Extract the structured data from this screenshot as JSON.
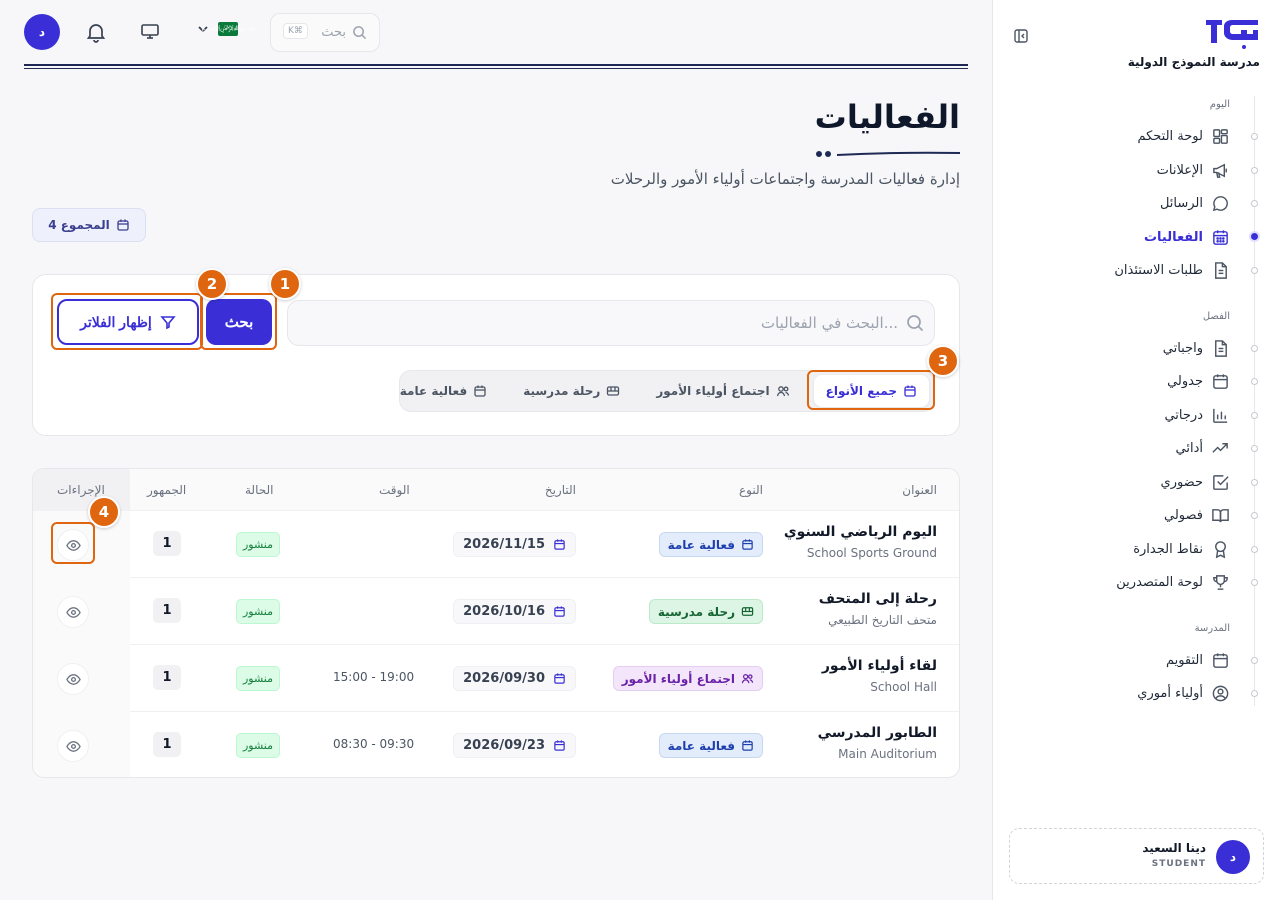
{
  "topbar": {
    "avatar_initial": "د",
    "search_placeholder": "بحث",
    "search_shortcut": "K⌘",
    "flag_text": "﷽",
    "icons": [
      "bell-icon",
      "monitor-icon",
      "chevron-down-icon",
      "search-icon"
    ]
  },
  "sidebar": {
    "school_name": "مدرسة النموذج الدولية",
    "sections": {
      "today": "اليوم",
      "class": "الفصل",
      "school": "المدرسة"
    },
    "items": [
      {
        "label": "لوحة التحكم",
        "icon": "dashboard-icon"
      },
      {
        "label": "الإعلانات",
        "icon": "megaphone-icon"
      },
      {
        "label": "الرسائل",
        "icon": "chat-icon"
      },
      {
        "label": "الفعاليات",
        "icon": "calendar-icon",
        "active": true
      },
      {
        "label": "طلبات الاستئذان",
        "icon": "document-icon"
      },
      {
        "label": "واجباتي",
        "icon": "document-icon"
      },
      {
        "label": "جدولي",
        "icon": "calendar-icon"
      },
      {
        "label": "درجاتي",
        "icon": "bar-chart-icon"
      },
      {
        "label": "أدائي",
        "icon": "trend-up-icon"
      },
      {
        "label": "حضوري",
        "icon": "check-square-icon"
      },
      {
        "label": "فصولي",
        "icon": "book-icon"
      },
      {
        "label": "نقاط الجدارة",
        "icon": "award-icon"
      },
      {
        "label": "لوحة المتصدرين",
        "icon": "trophy-icon"
      },
      {
        "label": "التقويم",
        "icon": "calendar-icon"
      },
      {
        "label": "أولياء أموري",
        "icon": "user-circle-icon"
      }
    ],
    "user": {
      "initial": "د",
      "name": "دينا السعيد",
      "role": "STUDENT"
    }
  },
  "page": {
    "title": "الفعاليات",
    "subtitle": "إدارة فعاليات المدرسة واجتماعات أولياء الأمور والرحلات",
    "total_badge": "4 المجموع"
  },
  "filters": {
    "search_placeholder": "البحث في الفعاليات...",
    "search_button": "بحث",
    "show_filters_button": "إظهار الفلاتر",
    "types": [
      {
        "label": "جميع الأنواع",
        "icon": "calendar-icon",
        "active": true
      },
      {
        "label": "اجتماع أولياء الأمور",
        "icon": "users-icon"
      },
      {
        "label": "رحلة مدرسية",
        "icon": "bus-icon"
      },
      {
        "label": "فعالية عامة",
        "icon": "calendar-icon"
      }
    ]
  },
  "table": {
    "headers": {
      "title": "العنوان",
      "type": "النوع",
      "date": "التاريخ",
      "time": "الوقت",
      "status": "الحالة",
      "audience": "الجمهور",
      "actions": "الإجراءات"
    },
    "rows": [
      {
        "title": "اليوم الرياضي السنوي",
        "location": "School Sports Ground",
        "type": "فعالية عامة",
        "type_kind": "general",
        "date": "2026/11/15",
        "time": "",
        "status": "منشور",
        "audience": "1"
      },
      {
        "title": "رحلة إلى المتحف",
        "location": "متحف التاريخ الطبيعي",
        "type": "رحلة مدرسية",
        "type_kind": "trip",
        "date": "2026/10/16",
        "time": "",
        "status": "منشور",
        "audience": "1"
      },
      {
        "title": "لقاء أولياء الأمور",
        "location": "School Hall",
        "type": "اجتماع أولياء الأمور",
        "type_kind": "meeting",
        "date": "2026/09/30",
        "time": "15:00 - 19:00",
        "status": "منشور",
        "audience": "1"
      },
      {
        "title": "الطابور المدرسي",
        "location": "Main Auditorium",
        "type": "فعالية عامة",
        "type_kind": "general",
        "date": "2026/09/23",
        "time": "08:30 - 09:30",
        "status": "منشور",
        "audience": "1"
      }
    ]
  },
  "annotations": [
    "1",
    "2",
    "3",
    "4"
  ],
  "colors": {
    "accent": "#3a2fd6",
    "annotation": "#e0650f",
    "navy": "#1e2a55"
  }
}
